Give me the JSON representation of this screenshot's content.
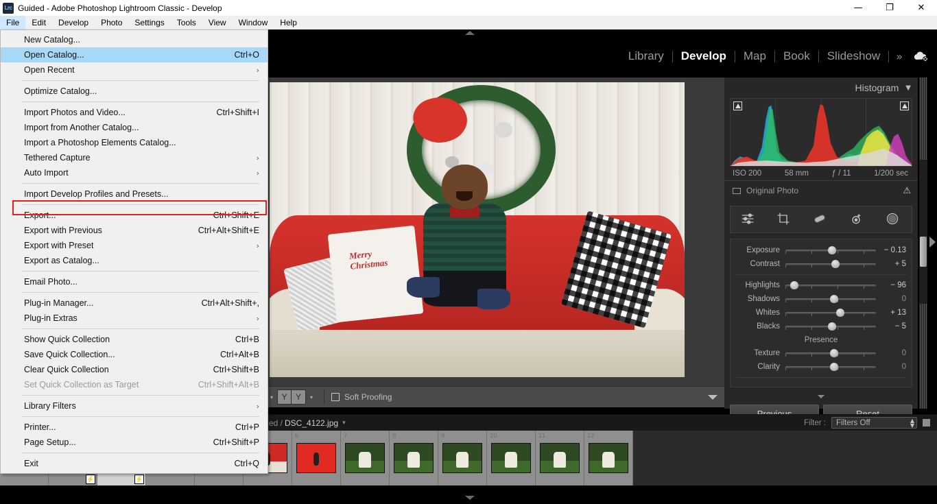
{
  "window": {
    "logo_text": "Lrc",
    "title": "Guided - Adobe Photoshop Lightroom Classic - Develop",
    "minimize": "—",
    "maximize": "❐",
    "close": "✕"
  },
  "menubar": {
    "items": [
      {
        "label": "File",
        "active": true
      },
      {
        "label": "Edit",
        "active": false
      },
      {
        "label": "Develop",
        "active": false
      },
      {
        "label": "Photo",
        "active": false
      },
      {
        "label": "Settings",
        "active": false
      },
      {
        "label": "Tools",
        "active": false
      },
      {
        "label": "View",
        "active": false
      },
      {
        "label": "Window",
        "active": false
      },
      {
        "label": "Help",
        "active": false
      }
    ]
  },
  "file_menu": {
    "items": [
      {
        "label": "New Catalog...",
        "accel": "",
        "arrow": false,
        "state": "normal"
      },
      {
        "label": "Open Catalog...",
        "accel": "Ctrl+O",
        "arrow": false,
        "state": "highlight"
      },
      {
        "label": "Open Recent",
        "accel": "",
        "arrow": true,
        "state": "normal"
      },
      {
        "sep": true
      },
      {
        "label": "Optimize Catalog...",
        "accel": "",
        "arrow": false,
        "state": "normal"
      },
      {
        "sep": true
      },
      {
        "label": "Import Photos and Video...",
        "accel": "Ctrl+Shift+I",
        "arrow": false,
        "state": "normal"
      },
      {
        "label": "Import from Another Catalog...",
        "accel": "",
        "arrow": false,
        "state": "normal"
      },
      {
        "label": "Import a Photoshop Elements Catalog...",
        "accel": "",
        "arrow": false,
        "state": "normal"
      },
      {
        "label": "Tethered Capture",
        "accel": "",
        "arrow": true,
        "state": "normal"
      },
      {
        "label": "Auto Import",
        "accel": "",
        "arrow": true,
        "state": "normal"
      },
      {
        "sep": true
      },
      {
        "label": "Import Develop Profiles and Presets...",
        "accel": "",
        "arrow": false,
        "state": "normal"
      },
      {
        "sep": true
      },
      {
        "label": "Export...",
        "accel": "Ctrl+Shift+E",
        "arrow": false,
        "state": "boxed"
      },
      {
        "label": "Export with Previous",
        "accel": "Ctrl+Alt+Shift+E",
        "arrow": false,
        "state": "normal"
      },
      {
        "label": "Export with Preset",
        "accel": "",
        "arrow": true,
        "state": "normal"
      },
      {
        "label": "Export as Catalog...",
        "accel": "",
        "arrow": false,
        "state": "normal"
      },
      {
        "sep": true
      },
      {
        "label": "Email Photo...",
        "accel": "",
        "arrow": false,
        "state": "normal"
      },
      {
        "sep": true
      },
      {
        "label": "Plug-in Manager...",
        "accel": "Ctrl+Alt+Shift+,",
        "arrow": false,
        "state": "normal"
      },
      {
        "label": "Plug-in Extras",
        "accel": "",
        "arrow": true,
        "state": "normal"
      },
      {
        "sep": true
      },
      {
        "label": "Show Quick Collection",
        "accel": "Ctrl+B",
        "arrow": false,
        "state": "normal"
      },
      {
        "label": "Save Quick Collection...",
        "accel": "Ctrl+Alt+B",
        "arrow": false,
        "state": "normal"
      },
      {
        "label": "Clear Quick Collection",
        "accel": "Ctrl+Shift+B",
        "arrow": false,
        "state": "normal"
      },
      {
        "label": "Set Quick Collection as Target",
        "accel": "Ctrl+Shift+Alt+B",
        "arrow": false,
        "state": "disabled"
      },
      {
        "sep": true
      },
      {
        "label": "Library Filters",
        "accel": "",
        "arrow": true,
        "state": "normal"
      },
      {
        "sep": true
      },
      {
        "label": "Printer...",
        "accel": "Ctrl+P",
        "arrow": false,
        "state": "normal"
      },
      {
        "label": "Page Setup...",
        "accel": "Ctrl+Shift+P",
        "arrow": false,
        "state": "normal"
      },
      {
        "sep": true
      },
      {
        "label": "Exit",
        "accel": "Ctrl+Q",
        "arrow": false,
        "state": "normal"
      }
    ]
  },
  "modules": {
    "items": [
      {
        "label": "Library",
        "active": false
      },
      {
        "label": "Develop",
        "active": true
      },
      {
        "label": "Map",
        "active": false
      },
      {
        "label": "Book",
        "active": false
      },
      {
        "label": "Slideshow",
        "active": false
      }
    ],
    "more": "»",
    "cloud_icon": "cloud-off-icon"
  },
  "histogram": {
    "title": "Histogram",
    "caret": "▼",
    "exif": {
      "iso": "ISO 200",
      "focal": "58 mm",
      "aperture": "ƒ / 11",
      "shutter": "1/200 sec"
    },
    "original_photo_label": "Original Photo",
    "warning_icon": "⚠"
  },
  "basic_panel": {
    "tools": [
      "basic-adjust-icon",
      "crop-icon",
      "spot-removal-icon",
      "red-eye-icon",
      "masking-icon"
    ],
    "sliders": [
      {
        "label": "Exposure",
        "value": "− 0.13",
        "pos": 47,
        "zero": false
      },
      {
        "label": "Contrast",
        "value": "+ 5",
        "pos": 51,
        "zero": false
      },
      {
        "label": "Highlights",
        "value": "− 96",
        "pos": 5,
        "zero": false
      },
      {
        "label": "Shadows",
        "value": "0",
        "pos": 49,
        "zero": true
      },
      {
        "label": "Whites",
        "value": "+ 13",
        "pos": 56,
        "zero": false
      },
      {
        "label": "Blacks",
        "value": "− 5",
        "pos": 47,
        "zero": false
      }
    ],
    "presence_title": "Presence",
    "presence_sliders": [
      {
        "label": "Texture",
        "value": "0",
        "pos": 49,
        "zero": true
      },
      {
        "label": "Clarity",
        "value": "0",
        "pos": 49,
        "zero": true
      }
    ],
    "previous_label": "Previous",
    "reset_label": "Reset"
  },
  "toolbar": {
    "caret_left": "▾",
    "yy_left": "Y",
    "yy_right": "Y",
    "caret_right": "▾",
    "soft_proofing_label": "Soft Proofing"
  },
  "filmstrip_header": {
    "path_fragment": "ed  /",
    "filename": "DSC_4122.jpg",
    "caret": "▾",
    "filter_label": "Filter :",
    "filter_value": "Filters Off"
  },
  "filmstrip": {
    "cells": [
      {
        "num": "",
        "style": "t-red",
        "badge": "",
        "selected": false
      },
      {
        "num": "",
        "style": "t-red",
        "badge": "⚡",
        "selected": false
      },
      {
        "num": "",
        "style": "t-red",
        "badge": "⚡",
        "selected": true
      },
      {
        "num": "",
        "style": "t-red",
        "badge": "",
        "selected": false
      },
      {
        "num": "",
        "style": "t-red",
        "badge": "",
        "selected": false
      },
      {
        "num": "",
        "style": "t-red",
        "badge": "",
        "selected": false
      },
      {
        "num": "6",
        "style": "t-red2",
        "badge": "",
        "selected": false
      },
      {
        "num": "7",
        "style": "t-green",
        "badge": "",
        "selected": false
      },
      {
        "num": "8",
        "style": "t-green",
        "badge": "",
        "selected": false
      },
      {
        "num": "9",
        "style": "t-green",
        "badge": "",
        "selected": false
      },
      {
        "num": "10",
        "style": "t-green",
        "badge": "",
        "selected": false
      },
      {
        "num": "11",
        "style": "t-green",
        "badge": "",
        "selected": false
      },
      {
        "num": "12",
        "style": "t-green",
        "badge": "",
        "selected": false
      }
    ]
  },
  "colors": {
    "highlight_blue": "#a8d8f8",
    "annotation_red": "#e02020",
    "panel_bg": "#272727",
    "menu_bg": "#f0f0f0"
  }
}
